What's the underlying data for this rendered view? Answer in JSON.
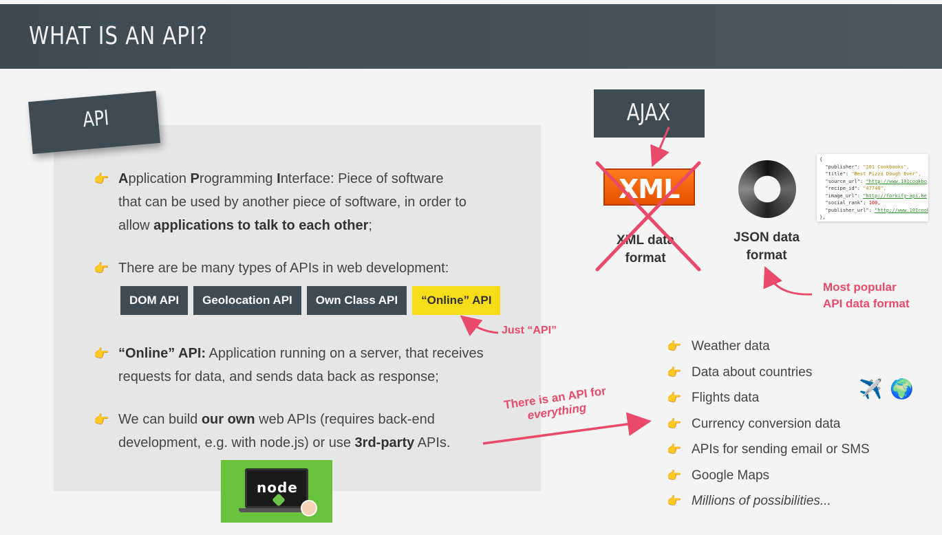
{
  "slide_title": "WHAT IS AN API?",
  "api_tag": "API",
  "bullets": {
    "b1_pre1": "A",
    "b1_mid1": "pplication ",
    "b1_pre2": "P",
    "b1_mid2": "rogramming ",
    "b1_pre3": "I",
    "b1_line1_rest": "nterface: Piece of software",
    "b1_line2": "that can be used by another piece of software, in order to",
    "b1_line3_pre": "allow ",
    "b1_line3_bold": "applications to talk to each other",
    "b1_line3_post": ";",
    "b2_line1": "There are be many types of APIs in web development:",
    "b3_bold": "“Online” API:",
    "b3_line1_rest": " Application running on a server, that receives",
    "b3_line2": "requests for data, and sends data back as response;",
    "b4_pre": "We can build ",
    "b4_bold1": "our own",
    "b4_mid": " web APIs (requires back-end",
    "b4_line2_pre": "development, e.g. with node.js) or use ",
    "b4_bold2": "3rd-party",
    "b4_line2_post": " APIs."
  },
  "api_types": [
    "DOM API",
    "Geolocation API",
    "Own Class API",
    "“Online” API"
  ],
  "notes": {
    "just_api": "Just “API”",
    "everything_line1": "There is an API for",
    "everything_line2": "everything",
    "most_popular_line1": "Most popular",
    "most_popular_line2": "API data format"
  },
  "ajax_label": "AJAX",
  "xml_logo": "XML",
  "xml_label_line1": "XML data",
  "xml_label_line2": "format",
  "json_label_line1": "JSON data",
  "json_label_line2": "format",
  "json_sample": {
    "open": "{",
    "k1": "  \"publisher\": ",
    "v1": "\"101 Cookbooks\",",
    "k2": "  \"title\": ",
    "v2": "\"Best Pizza Dough Ever\",",
    "k3": "  \"source_url\": ",
    "v3": "\"http://www.101cookbo",
    "k4": "  \"recipe_id\": ",
    "v4": "\"47746\",",
    "k5": "  \"image_url\": ",
    "v5": "\"http://forkify-api.he",
    "k6": "  \"social_rank\": ",
    "v6": "100,",
    "k7": "  \"publisher_url\": ",
    "v7": "\"http://www.101cook",
    "close": "},"
  },
  "api_examples": [
    "Weather data",
    "Data about countries",
    "Flights data",
    "Currency conversion data",
    "APIs for sending email or SMS",
    "Google Maps",
    "Millions of possibilities..."
  ],
  "hand_glyph": "👉",
  "emoji_plane": "✈️",
  "emoji_globe": "🌍",
  "node_logo_text": "node",
  "colors": {
    "header_bg": "#3e4b53",
    "accent_pink": "#ea4a6a",
    "chip_yellow": "#f7dd18",
    "xml_orange": "#ff6a00"
  }
}
